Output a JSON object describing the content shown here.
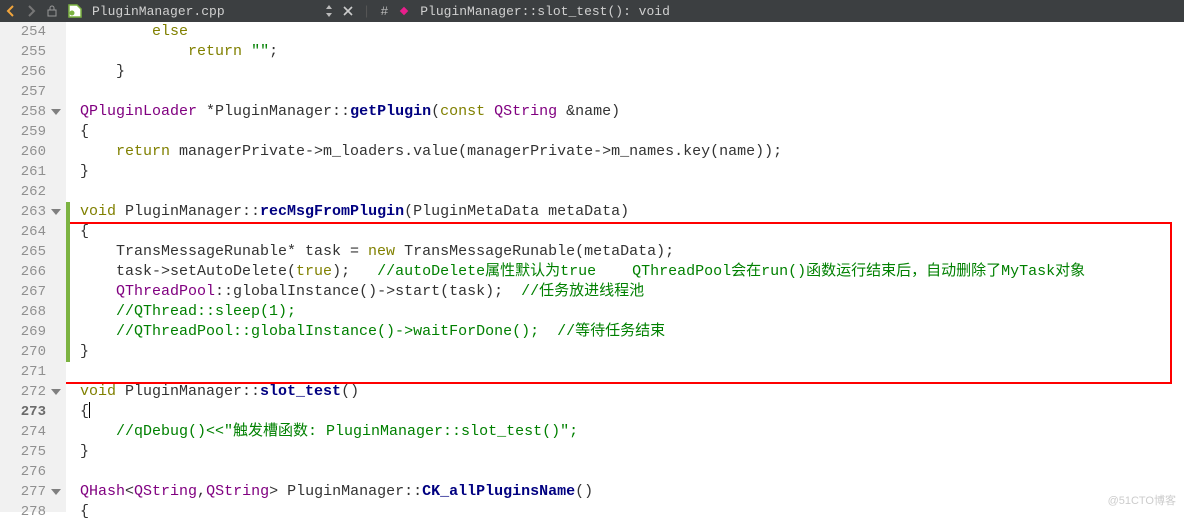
{
  "toolbar": {
    "filename": "PluginManager.cpp",
    "hash": "#",
    "breadcrumb": "PluginManager::slot_test(): void"
  },
  "gutter": {
    "start": 254,
    "end": 278,
    "bold": 273,
    "folds": [
      258,
      263,
      272,
      277
    ]
  },
  "changebars": [
    {
      "from": 263,
      "to": 270
    }
  ],
  "highlight_box": {
    "from": 263,
    "to": 270
  },
  "code": {
    "254": [
      [
        "",
        "        "
      ],
      [
        "kw",
        "else"
      ]
    ],
    "255": [
      [
        "",
        "            "
      ],
      [
        "kw",
        "return"
      ],
      [
        "",
        " "
      ],
      [
        "str",
        "\"\""
      ],
      [
        "",
        ";"
      ]
    ],
    "256": [
      [
        "",
        "    }"
      ]
    ],
    "257": [
      [
        "",
        ""
      ]
    ],
    "258": [
      [
        "type",
        "QPluginLoader"
      ],
      [
        "",
        " *PluginManager::"
      ],
      [
        "fn",
        "getPlugin"
      ],
      [
        "",
        "("
      ],
      [
        "kw",
        "const"
      ],
      [
        "",
        " "
      ],
      [
        "type",
        "QString"
      ],
      [
        "",
        " &name)"
      ]
    ],
    "259": [
      [
        "",
        "{"
      ]
    ],
    "260": [
      [
        "",
        "    "
      ],
      [
        "kw",
        "return"
      ],
      [
        "",
        " managerPrivate->m_loaders.value(managerPrivate->m_names.key(name));"
      ]
    ],
    "261": [
      [
        "",
        "}"
      ]
    ],
    "262": [
      [
        "",
        ""
      ]
    ],
    "263": [
      [
        "kw",
        "void"
      ],
      [
        "",
        " PluginManager::"
      ],
      [
        "fn",
        "recMsgFromPlugin"
      ],
      [
        "",
        "(PluginMetaData metaData)"
      ]
    ],
    "264": [
      [
        "",
        "{"
      ]
    ],
    "265": [
      [
        "",
        "    TransMessageRunable* task = "
      ],
      [
        "kw",
        "new"
      ],
      [
        "",
        " TransMessageRunable(metaData);"
      ]
    ],
    "266": [
      [
        "",
        "    task->setAutoDelete("
      ],
      [
        "kw",
        "true"
      ],
      [
        "",
        ");   "
      ],
      [
        "cmt",
        "//autoDelete属性默认为true    QThreadPool会在run()函数运行结束后，自动删除了MyTask对象"
      ]
    ],
    "267": [
      [
        "",
        "    "
      ],
      [
        "type",
        "QThreadPool"
      ],
      [
        "",
        "::globalInstance()->start(task);  "
      ],
      [
        "cmt",
        "//任务放进线程池"
      ]
    ],
    "268": [
      [
        "",
        "    "
      ],
      [
        "cmt",
        "//QThread::sleep(1);"
      ]
    ],
    "269": [
      [
        "",
        "    "
      ],
      [
        "cmt",
        "//QThreadPool::globalInstance()->waitForDone();  //等待任务结束"
      ]
    ],
    "270": [
      [
        "",
        "}"
      ]
    ],
    "271": [
      [
        "",
        ""
      ]
    ],
    "272": [
      [
        "kw",
        "void"
      ],
      [
        "",
        " PluginManager::"
      ],
      [
        "fn",
        "slot_test"
      ],
      [
        "",
        "()"
      ]
    ],
    "273": [
      [
        "",
        "{"
      ],
      [
        "cursor",
        ""
      ]
    ],
    "274": [
      [
        "",
        "    "
      ],
      [
        "cmt",
        "//qDebug()<<\"触发槽函数: PluginManager::slot_test()\";"
      ]
    ],
    "275": [
      [
        "",
        "}"
      ]
    ],
    "276": [
      [
        "",
        ""
      ]
    ],
    "277": [
      [
        "type",
        "QHash"
      ],
      [
        "",
        "<"
      ],
      [
        "type",
        "QString"
      ],
      [
        "",
        ","
      ],
      [
        "type",
        "QString"
      ],
      [
        "",
        "> PluginManager::"
      ],
      [
        "fn",
        "CK_allPluginsName"
      ],
      [
        "",
        "()"
      ]
    ],
    "278": [
      [
        "",
        "{"
      ]
    ]
  },
  "watermark": "@51CTO博客"
}
